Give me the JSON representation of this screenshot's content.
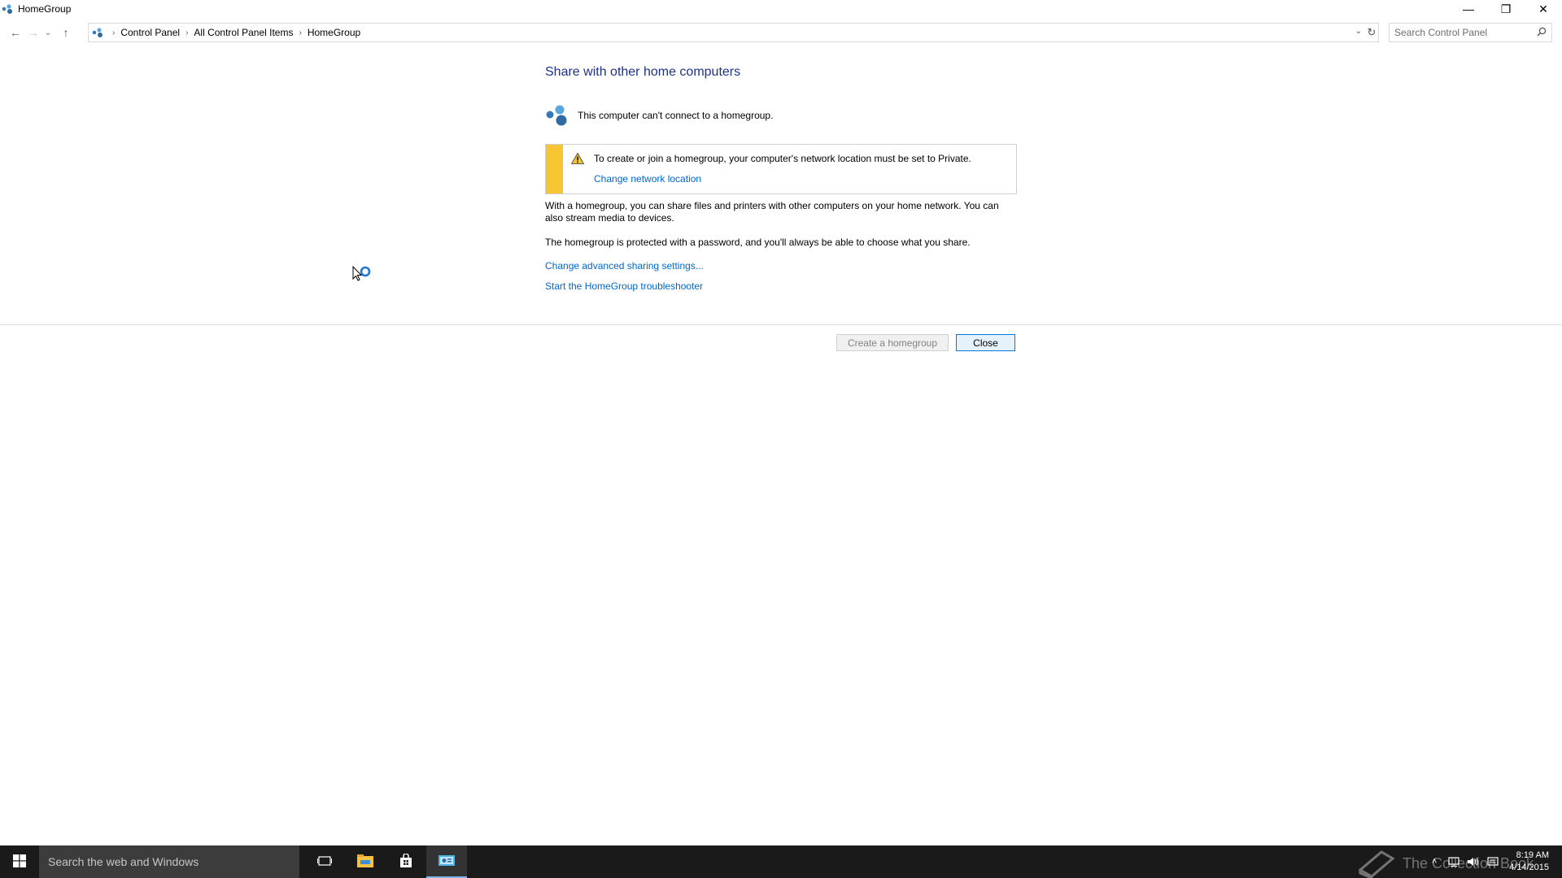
{
  "window": {
    "title": "HomeGroup",
    "minimize_glyph": "—",
    "restore_glyph": "❐",
    "close_glyph": "✕"
  },
  "nav": {
    "back_glyph": "←",
    "forward_glyph": "→",
    "recent_glyph": "⌄",
    "up_glyph": "↑",
    "breadcrumb": [
      "Control Panel",
      "All Control Panel Items",
      "HomeGroup"
    ],
    "separator": "›",
    "dropdown_glyph": "⌄",
    "refresh_glyph": "↻",
    "search_placeholder": "Search Control Panel"
  },
  "main": {
    "heading": "Share with other home computers",
    "status": "This computer can't connect to a homegroup.",
    "warning_text": "To create or join a homegroup, your computer's network location must be set to Private.",
    "warning_link": "Change network location",
    "para1": "With a homegroup, you can share files and printers with other computers on your home network. You can also stream media to devices.",
    "para2": "The homegroup is protected with a password, and you'll always be able to choose what you share.",
    "link_advanced": "Change advanced sharing settings...",
    "link_troubleshooter": "Start the HomeGroup troubleshooter",
    "create_button": "Create a homegroup",
    "close_button": "Close"
  },
  "taskbar": {
    "search_placeholder": "Search the web and Windows",
    "watermark": "The Collection Book",
    "tray_chevron": "˄",
    "time": "8:19 AM",
    "date": "4/14/2015"
  },
  "colors": {
    "heading": "#1e3287",
    "link": "#0066cc",
    "warning_bar": "#f7c531",
    "taskbar": "#1a1a1a",
    "taskbar_search": "#3c3c3c"
  },
  "icons": [
    "homegroup-icon",
    "warning-icon",
    "search-icon",
    "windows-logo-icon",
    "task-view-icon",
    "file-explorer-icon",
    "store-icon",
    "control-panel-icon",
    "network-icon",
    "volume-icon",
    "action-center-icon"
  ]
}
